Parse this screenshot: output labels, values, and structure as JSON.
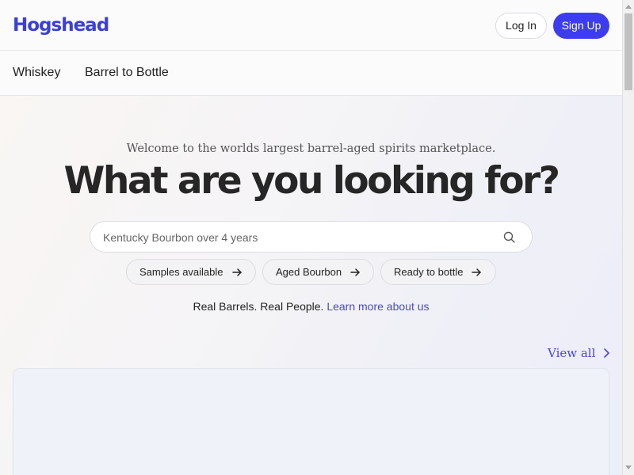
{
  "header": {
    "logo": "Hogshead",
    "login_label": "Log In",
    "signup_label": "Sign Up"
  },
  "nav": {
    "items": [
      {
        "label": "Whiskey"
      },
      {
        "label": "Barrel to Bottle"
      }
    ]
  },
  "hero": {
    "welcome": "Welcome to the worlds largest barrel-aged spirits marketplace.",
    "headline": "What are you looking for?",
    "search": {
      "placeholder": "Kentucky Bourbon over 4 years",
      "icon": "search-icon"
    },
    "chips": [
      {
        "label": "Samples available",
        "icon": "arrow-right-icon"
      },
      {
        "label": "Aged Bourbon",
        "icon": "arrow-right-icon"
      },
      {
        "label": "Ready to bottle",
        "icon": "arrow-right-icon"
      }
    ],
    "tagline": "Real Barrels. Real People.",
    "learn_more": "Learn more about us",
    "view_all": "View all"
  },
  "colors": {
    "brand": "#3b3fd8",
    "signup_bg": "#3d3cf0",
    "link": "#4a48d0"
  }
}
